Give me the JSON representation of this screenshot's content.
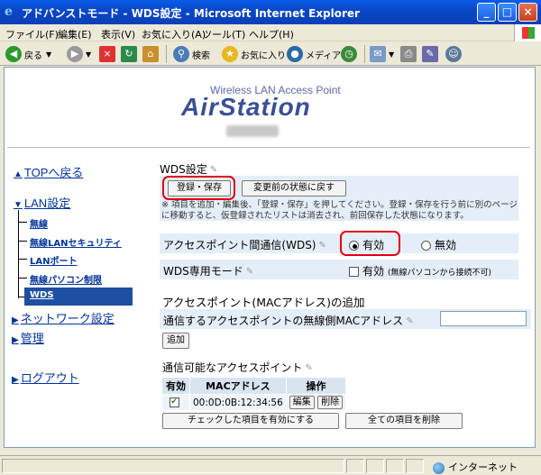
{
  "window": {
    "title": "アドバンストモード - WDS設定 - Microsoft Internet Explorer",
    "minimize_icon": "minimize-icon",
    "maximize_icon": "maximize-icon",
    "close_icon": "close-icon"
  },
  "menu": {
    "items": [
      "ファイル(F)",
      "編集(E)",
      "表示(V)",
      "お気に入り(A)",
      "ツール(T)",
      "ヘルプ(H)"
    ]
  },
  "toolbar": {
    "back": "戻る",
    "search": "検索",
    "favorites": "お気に入り",
    "media": "メディア"
  },
  "header": {
    "tagline": "Wireless LAN Access Point",
    "logo": "AirStation"
  },
  "nav": {
    "top": "TOPへ戻る",
    "lan": "LAN設定",
    "lan_items": [
      "無線",
      "無線LANセキュリティ",
      "LANポート",
      "無線パソコン制限",
      "WDS"
    ],
    "network": "ネットワーク設定",
    "admin": "管理",
    "logout": "ログアウト"
  },
  "wds": {
    "heading": "WDS設定",
    "save_label": "登録・保存",
    "revert_label": "変更前の状態に戻す",
    "note": "※ 項目を追加・編集後、「登録・保存」を押してください。登録・保存を行う前に別のページに移動すると、仮登録されたリストは消去され、前回保存した状態になります。",
    "ap_comm_label": "アクセスポイント間通信(WDS)",
    "enabled_label": "有効",
    "disabled_label": "無効",
    "ap_comm_selected": "有効",
    "dedicated_label": "WDS専用モード",
    "dedicated_checkbox_label": "有効",
    "dedicated_note": "(無線パソコンから接続不可)",
    "dedicated_checked": false
  },
  "add": {
    "heading": "アクセスポイント(MACアドレス)の追加",
    "mac_label": "通信するアクセスポイントの無線側MACアドレス",
    "mac_value": "",
    "add_button": "追加"
  },
  "list": {
    "heading": "通信可能なアクセスポイント",
    "columns": [
      "有効",
      "MACアドレス",
      "操作"
    ],
    "rows": [
      {
        "enabled": true,
        "mac": "00:0D:0B:12:34:56",
        "edit": "編集",
        "delete": "削除"
      }
    ],
    "enable_checked_button": "チェックした項目を有効にする",
    "delete_all_button": "全ての項目を削除"
  },
  "status": {
    "zone": "インターネット"
  }
}
